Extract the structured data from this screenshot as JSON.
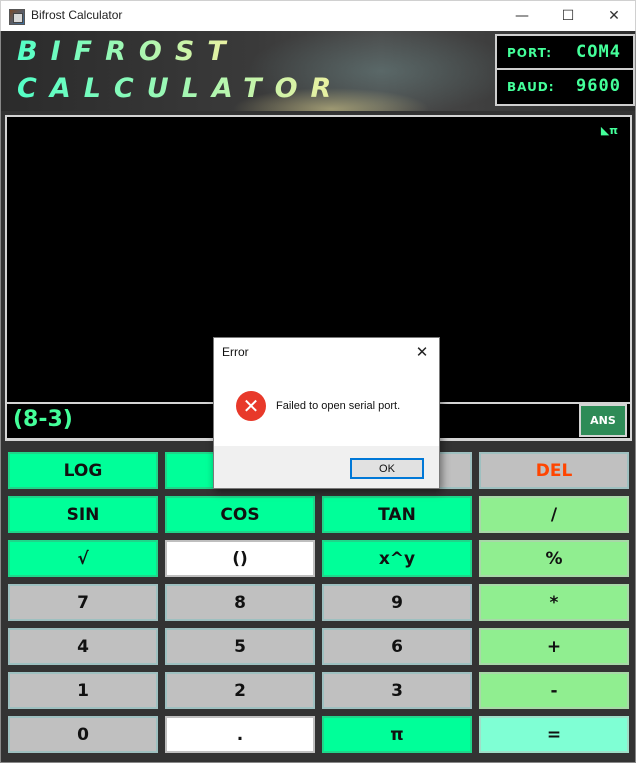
{
  "window": {
    "title": "Bifrost Calculator",
    "minimize_icon": "—",
    "maximize_icon": "☐",
    "close_icon": "✕"
  },
  "header": {
    "brand_line1": "BIFROST",
    "brand_line2": "CALCULATOR",
    "port_label": "PORT:",
    "port_value": "COM4",
    "baud_label": "BAUD:",
    "baud_value": "9600"
  },
  "display": {
    "pi_indicator": "◣π",
    "expression": "(8-3)",
    "ans_label": "ANS"
  },
  "keypad": {
    "row0": [
      "LOG",
      "",
      "",
      "DEL"
    ],
    "row1": [
      "SIN",
      "COS",
      "TAN",
      "/"
    ],
    "row2": [
      "√",
      "()",
      "x^y",
      "%"
    ],
    "row3": [
      "7",
      "8",
      "9",
      "*"
    ],
    "row4": [
      "4",
      "5",
      "6",
      "+"
    ],
    "row5": [
      "1",
      "2",
      "3",
      "-"
    ],
    "row6": [
      "0",
      ".",
      "π",
      "="
    ]
  },
  "dialog": {
    "title": "Error",
    "close_icon": "✕",
    "error_icon": "✕",
    "message": "Failed to open serial port.",
    "ok_label": "OK"
  },
  "colors": {
    "function_key": "#00ff99",
    "digit_key": "#c0c0c0",
    "operator_key": "#90ee90",
    "equals_key": "#7fffd4",
    "delete_text": "#ff4500",
    "display_text": "#44ff9a"
  }
}
